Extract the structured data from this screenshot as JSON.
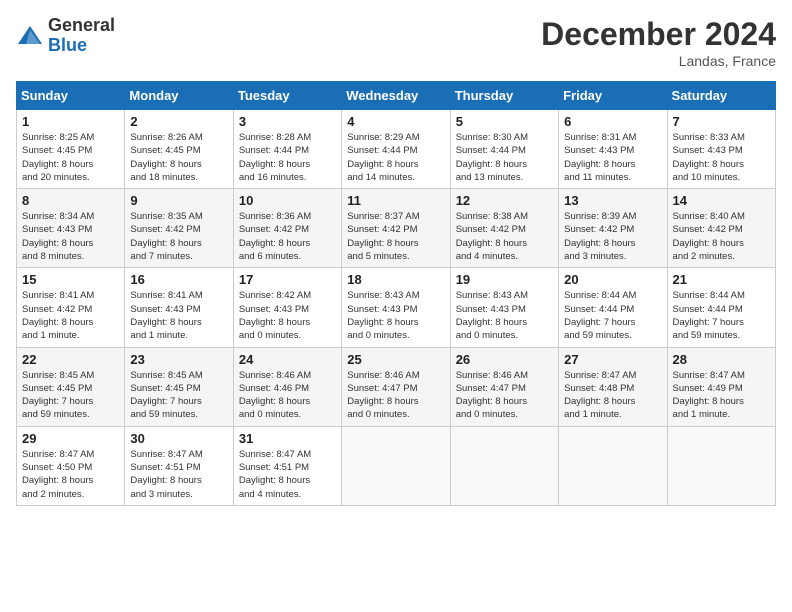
{
  "header": {
    "logo_general": "General",
    "logo_blue": "Blue",
    "month_title": "December 2024",
    "location": "Landas, France"
  },
  "weekdays": [
    "Sunday",
    "Monday",
    "Tuesday",
    "Wednesday",
    "Thursday",
    "Friday",
    "Saturday"
  ],
  "weeks": [
    [
      {
        "day": "1",
        "info": "Sunrise: 8:25 AM\nSunset: 4:45 PM\nDaylight: 8 hours\nand 20 minutes."
      },
      {
        "day": "2",
        "info": "Sunrise: 8:26 AM\nSunset: 4:45 PM\nDaylight: 8 hours\nand 18 minutes."
      },
      {
        "day": "3",
        "info": "Sunrise: 8:28 AM\nSunset: 4:44 PM\nDaylight: 8 hours\nand 16 minutes."
      },
      {
        "day": "4",
        "info": "Sunrise: 8:29 AM\nSunset: 4:44 PM\nDaylight: 8 hours\nand 14 minutes."
      },
      {
        "day": "5",
        "info": "Sunrise: 8:30 AM\nSunset: 4:44 PM\nDaylight: 8 hours\nand 13 minutes."
      },
      {
        "day": "6",
        "info": "Sunrise: 8:31 AM\nSunset: 4:43 PM\nDaylight: 8 hours\nand 11 minutes."
      },
      {
        "day": "7",
        "info": "Sunrise: 8:33 AM\nSunset: 4:43 PM\nDaylight: 8 hours\nand 10 minutes."
      }
    ],
    [
      {
        "day": "8",
        "info": "Sunrise: 8:34 AM\nSunset: 4:43 PM\nDaylight: 8 hours\nand 8 minutes."
      },
      {
        "day": "9",
        "info": "Sunrise: 8:35 AM\nSunset: 4:42 PM\nDaylight: 8 hours\nand 7 minutes."
      },
      {
        "day": "10",
        "info": "Sunrise: 8:36 AM\nSunset: 4:42 PM\nDaylight: 8 hours\nand 6 minutes."
      },
      {
        "day": "11",
        "info": "Sunrise: 8:37 AM\nSunset: 4:42 PM\nDaylight: 8 hours\nand 5 minutes."
      },
      {
        "day": "12",
        "info": "Sunrise: 8:38 AM\nSunset: 4:42 PM\nDaylight: 8 hours\nand 4 minutes."
      },
      {
        "day": "13",
        "info": "Sunrise: 8:39 AM\nSunset: 4:42 PM\nDaylight: 8 hours\nand 3 minutes."
      },
      {
        "day": "14",
        "info": "Sunrise: 8:40 AM\nSunset: 4:42 PM\nDaylight: 8 hours\nand 2 minutes."
      }
    ],
    [
      {
        "day": "15",
        "info": "Sunrise: 8:41 AM\nSunset: 4:42 PM\nDaylight: 8 hours\nand 1 minute."
      },
      {
        "day": "16",
        "info": "Sunrise: 8:41 AM\nSunset: 4:43 PM\nDaylight: 8 hours\nand 1 minute."
      },
      {
        "day": "17",
        "info": "Sunrise: 8:42 AM\nSunset: 4:43 PM\nDaylight: 8 hours\nand 0 minutes."
      },
      {
        "day": "18",
        "info": "Sunrise: 8:43 AM\nSunset: 4:43 PM\nDaylight: 8 hours\nand 0 minutes."
      },
      {
        "day": "19",
        "info": "Sunrise: 8:43 AM\nSunset: 4:43 PM\nDaylight: 8 hours\nand 0 minutes."
      },
      {
        "day": "20",
        "info": "Sunrise: 8:44 AM\nSunset: 4:44 PM\nDaylight: 7 hours\nand 59 minutes."
      },
      {
        "day": "21",
        "info": "Sunrise: 8:44 AM\nSunset: 4:44 PM\nDaylight: 7 hours\nand 59 minutes."
      }
    ],
    [
      {
        "day": "22",
        "info": "Sunrise: 8:45 AM\nSunset: 4:45 PM\nDaylight: 7 hours\nand 59 minutes."
      },
      {
        "day": "23",
        "info": "Sunrise: 8:45 AM\nSunset: 4:45 PM\nDaylight: 7 hours\nand 59 minutes."
      },
      {
        "day": "24",
        "info": "Sunrise: 8:46 AM\nSunset: 4:46 PM\nDaylight: 8 hours\nand 0 minutes."
      },
      {
        "day": "25",
        "info": "Sunrise: 8:46 AM\nSunset: 4:47 PM\nDaylight: 8 hours\nand 0 minutes."
      },
      {
        "day": "26",
        "info": "Sunrise: 8:46 AM\nSunset: 4:47 PM\nDaylight: 8 hours\nand 0 minutes."
      },
      {
        "day": "27",
        "info": "Sunrise: 8:47 AM\nSunset: 4:48 PM\nDaylight: 8 hours\nand 1 minute."
      },
      {
        "day": "28",
        "info": "Sunrise: 8:47 AM\nSunset: 4:49 PM\nDaylight: 8 hours\nand 1 minute."
      }
    ],
    [
      {
        "day": "29",
        "info": "Sunrise: 8:47 AM\nSunset: 4:50 PM\nDaylight: 8 hours\nand 2 minutes."
      },
      {
        "day": "30",
        "info": "Sunrise: 8:47 AM\nSunset: 4:51 PM\nDaylight: 8 hours\nand 3 minutes."
      },
      {
        "day": "31",
        "info": "Sunrise: 8:47 AM\nSunset: 4:51 PM\nDaylight: 8 hours\nand 4 minutes."
      },
      null,
      null,
      null,
      null
    ]
  ]
}
